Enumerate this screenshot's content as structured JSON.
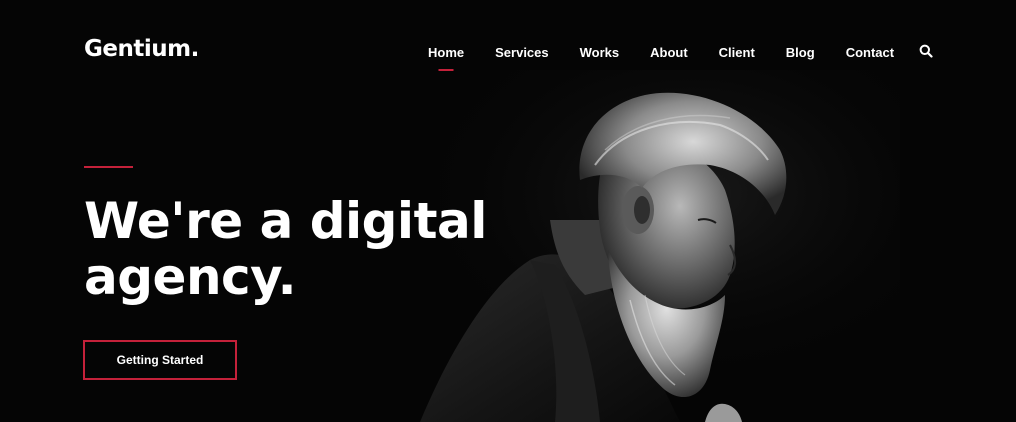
{
  "brand": {
    "logo_text": "Gentium."
  },
  "nav": {
    "items": [
      {
        "label": "Home",
        "active": true
      },
      {
        "label": "Services",
        "active": false
      },
      {
        "label": "Works",
        "active": false
      },
      {
        "label": "About",
        "active": false
      },
      {
        "label": "Client",
        "active": false
      },
      {
        "label": "Blog",
        "active": false
      },
      {
        "label": "Contact",
        "active": false
      }
    ],
    "search_icon": "search-icon"
  },
  "hero": {
    "title_line_1": "We're a digital",
    "title_line_2": "agency.",
    "cta_label": "Getting Started",
    "image": "bearded-man-portrait"
  },
  "colors": {
    "background": "#050505",
    "accent": "#c4213a",
    "text": "#ffffff"
  }
}
